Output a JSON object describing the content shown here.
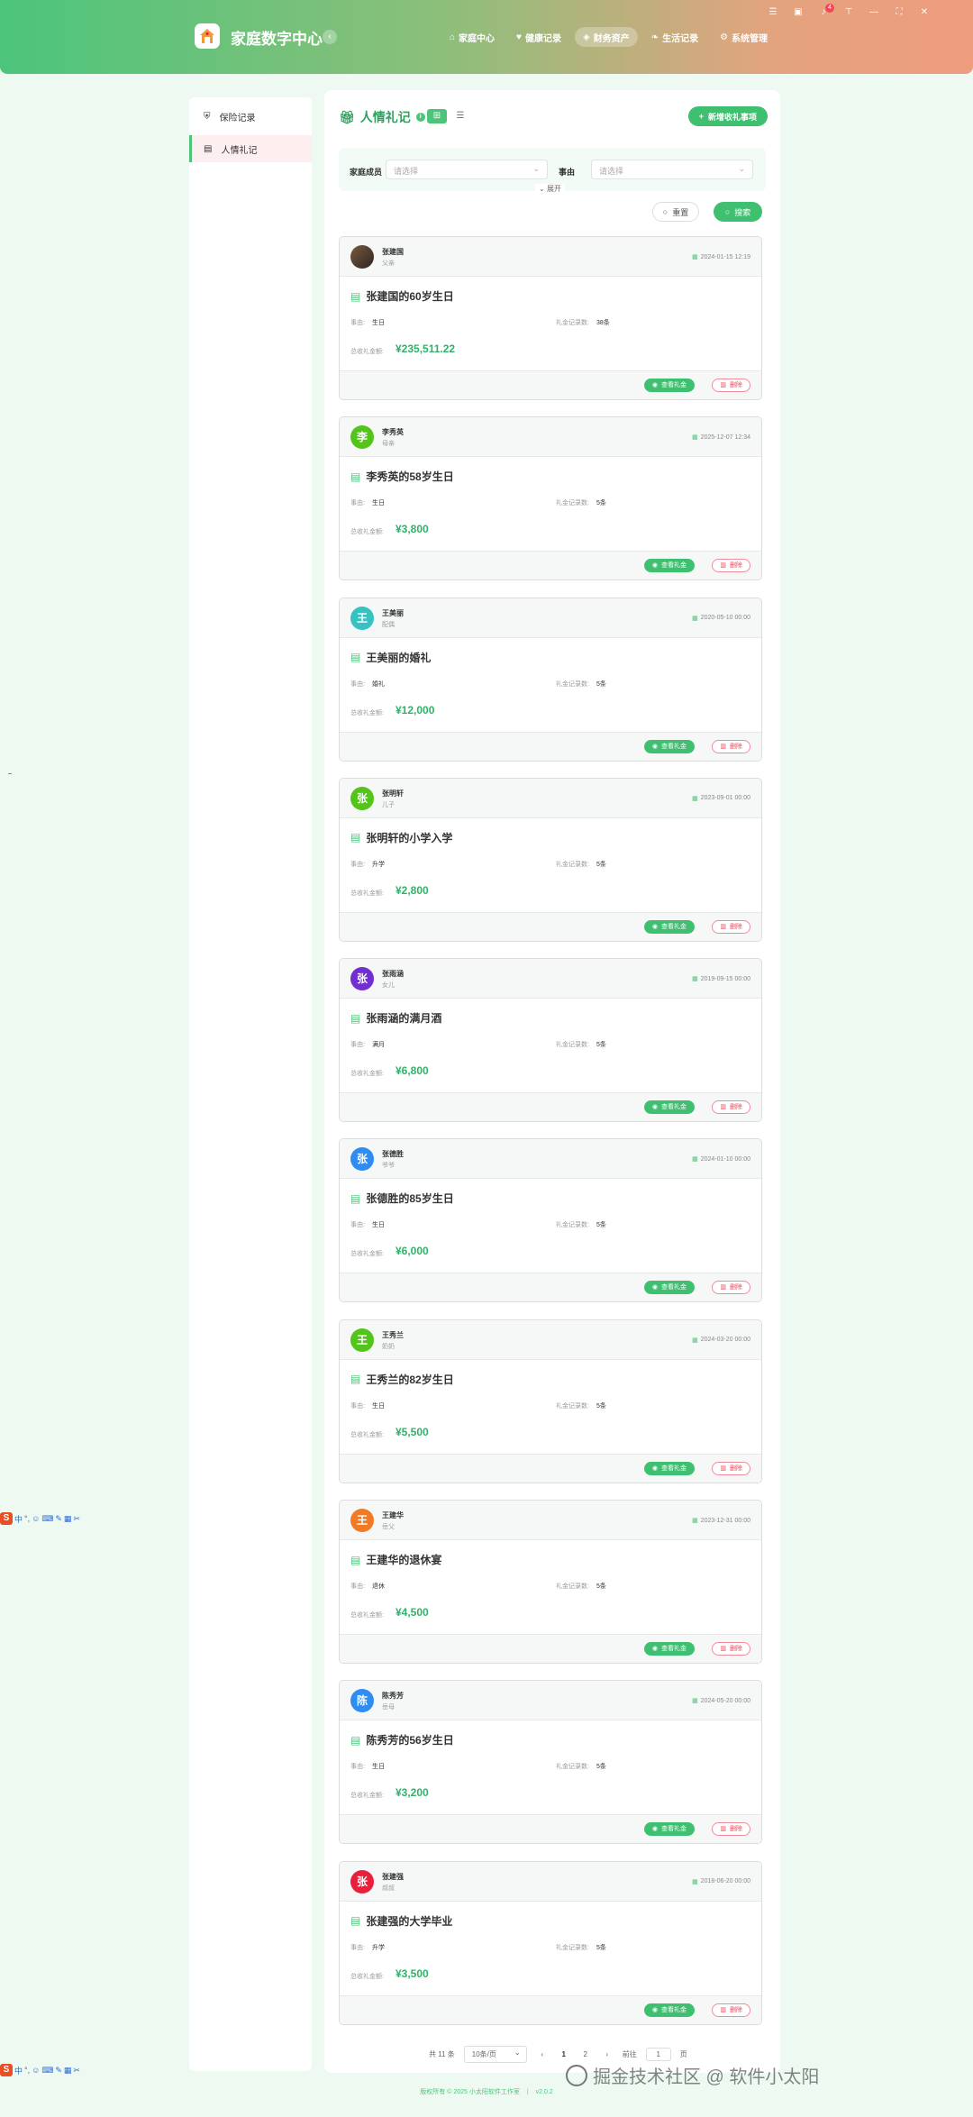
{
  "header": {
    "app_title": "家庭数字中心",
    "nav": [
      {
        "label": "家庭中心",
        "icon": "home-icon",
        "glyph": "⌂"
      },
      {
        "label": "健康记录",
        "icon": "heart-icon",
        "glyph": "♥"
      },
      {
        "label": "财务资产",
        "icon": "wallet-icon",
        "glyph": "◈"
      },
      {
        "label": "生活记录",
        "icon": "leaf-icon",
        "glyph": "❧"
      },
      {
        "label": "系统管理",
        "icon": "cog-icon",
        "glyph": "⚙"
      }
    ],
    "active_nav": 2,
    "notification_count": "4"
  },
  "sidebar": {
    "items": [
      {
        "label": "保险记录",
        "icon": "shield-icon"
      },
      {
        "label": "人情礼记",
        "icon": "gift-icon"
      }
    ],
    "active": 1
  },
  "panel": {
    "title": "人情礼记",
    "add_button": "新增收礼事项",
    "filters": {
      "member_label": "家庭成员",
      "member_placeholder": "请选择",
      "reason_label": "事由",
      "reason_placeholder": "请选择",
      "expand_label": "展开"
    },
    "reset_button": "重置",
    "search_button": "搜索"
  },
  "card_labels": {
    "reason": "事由:",
    "record_count": "礼金记录数:",
    "total_amount": "总收礼金额:",
    "view_button": "查看礼金",
    "delete_button": "删除"
  },
  "records": [
    {
      "name": "张建国",
      "relation": "父亲",
      "avatar": "",
      "avatar_color": "",
      "date": "2024-01-15 12:19",
      "title": "张建国的60岁生日",
      "reason": "生日",
      "count": "38条",
      "amount": "¥235,511.22"
    },
    {
      "name": "李秀英",
      "relation": "母亲",
      "avatar": "李",
      "avatar_color": "#52c41a",
      "date": "2025-12-07 12:34",
      "title": "李秀英的58岁生日",
      "reason": "生日",
      "count": "5条",
      "amount": "¥3,800"
    },
    {
      "name": "王美丽",
      "relation": "配偶",
      "avatar": "王",
      "avatar_color": "#36c2c2",
      "date": "2020-05-10 00:00",
      "title": "王美丽的婚礼",
      "reason": "婚礼",
      "count": "5条",
      "amount": "¥12,000"
    },
    {
      "name": "张明轩",
      "relation": "儿子",
      "avatar": "张",
      "avatar_color": "#52c41a",
      "date": "2023-09-01 00:00",
      "title": "张明轩的小学入学",
      "reason": "升学",
      "count": "5条",
      "amount": "¥2,800"
    },
    {
      "name": "张雨涵",
      "relation": "女儿",
      "avatar": "张",
      "avatar_color": "#722ed1",
      "date": "2019-09-15 00:00",
      "title": "张雨涵的满月酒",
      "reason": "满月",
      "count": "5条",
      "amount": "¥6,800"
    },
    {
      "name": "张德胜",
      "relation": "爷爷",
      "avatar": "张",
      "avatar_color": "#2f8cf0",
      "date": "2024-01-10 00:00",
      "title": "张德胜的85岁生日",
      "reason": "生日",
      "count": "5条",
      "amount": "¥6,000"
    },
    {
      "name": "王秀兰",
      "relation": "奶奶",
      "avatar": "王",
      "avatar_color": "#52c41a",
      "date": "2024-03-20 00:00",
      "title": "王秀兰的82岁生日",
      "reason": "生日",
      "count": "5条",
      "amount": "¥5,500"
    },
    {
      "name": "王建华",
      "relation": "岳父",
      "avatar": "王",
      "avatar_color": "#f07b24",
      "date": "2023-12-31 00:00",
      "title": "王建华的退休宴",
      "reason": "退休",
      "count": "5条",
      "amount": "¥4,500"
    },
    {
      "name": "陈秀芳",
      "relation": "岳母",
      "avatar": "陈",
      "avatar_color": "#2f8cf0",
      "date": "2024-05-20 00:00",
      "title": "陈秀芳的56岁生日",
      "reason": "生日",
      "count": "5条",
      "amount": "¥3,200"
    },
    {
      "name": "张建强",
      "relation": "叔叔",
      "avatar": "张",
      "avatar_color": "#e8203c",
      "date": "2018-06-20 00:00",
      "title": "张建强的大学毕业",
      "reason": "升学",
      "count": "5条",
      "amount": "¥3,500"
    }
  ],
  "pagination": {
    "total": "共 11 条",
    "page_size": "10条/页",
    "pages": [
      "1",
      "2"
    ],
    "current": "1",
    "goto_label": "前往",
    "goto_value": "1",
    "page_suffix": "页"
  },
  "footer": {
    "copyright": "版权所有 © 2025 小太阳软件工作室",
    "version": "v2.0.2"
  },
  "watermark": "掘金技术社区 @ 软件小太阳",
  "ime_glyphs": [
    "中",
    "°,",
    "☺",
    "⌨",
    "✎",
    "▦",
    "✂"
  ]
}
